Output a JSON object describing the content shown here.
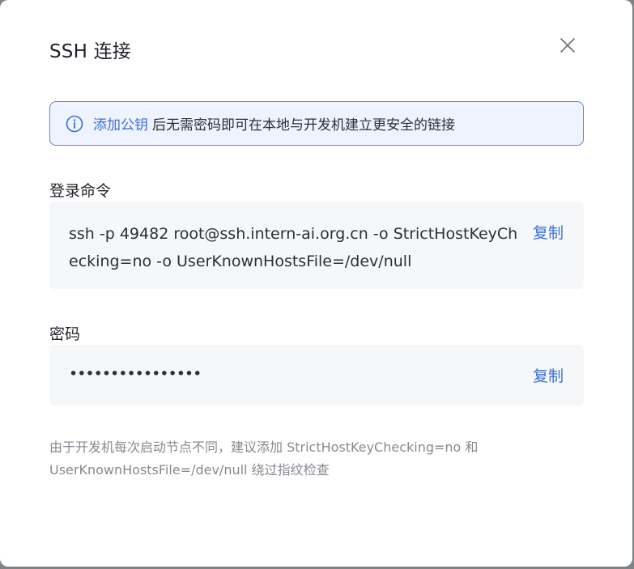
{
  "dialog": {
    "title": "SSH 连接"
  },
  "alert": {
    "link_label": "添加公钥",
    "message": "后无需密码即可在本地与开发机建立更安全的链接"
  },
  "login_command": {
    "label": "登录命令",
    "value": "ssh -p 49482 root@ssh.intern-ai.org.cn -o StrictHostKeyChecking=no -o UserKnownHostsFile=/dev/null",
    "copy_label": "复制"
  },
  "password": {
    "label": "密码",
    "masked_value": "••••••••••••••••",
    "copy_label": "复制"
  },
  "note": {
    "text": "由于开发机每次启动节点不同，建议添加 StrictHostKeyChecking=no 和 UserKnownHostsFile=/dev/null 绕过指纹检查"
  },
  "colors": {
    "accent": "#3b6fd8",
    "alert_bg": "#eef3fe",
    "alert_border": "#5b84de",
    "box_bg": "#f6f7f9",
    "note_text": "#86898f"
  },
  "icons": {
    "close": "close-icon",
    "info": "info-circle-icon"
  }
}
